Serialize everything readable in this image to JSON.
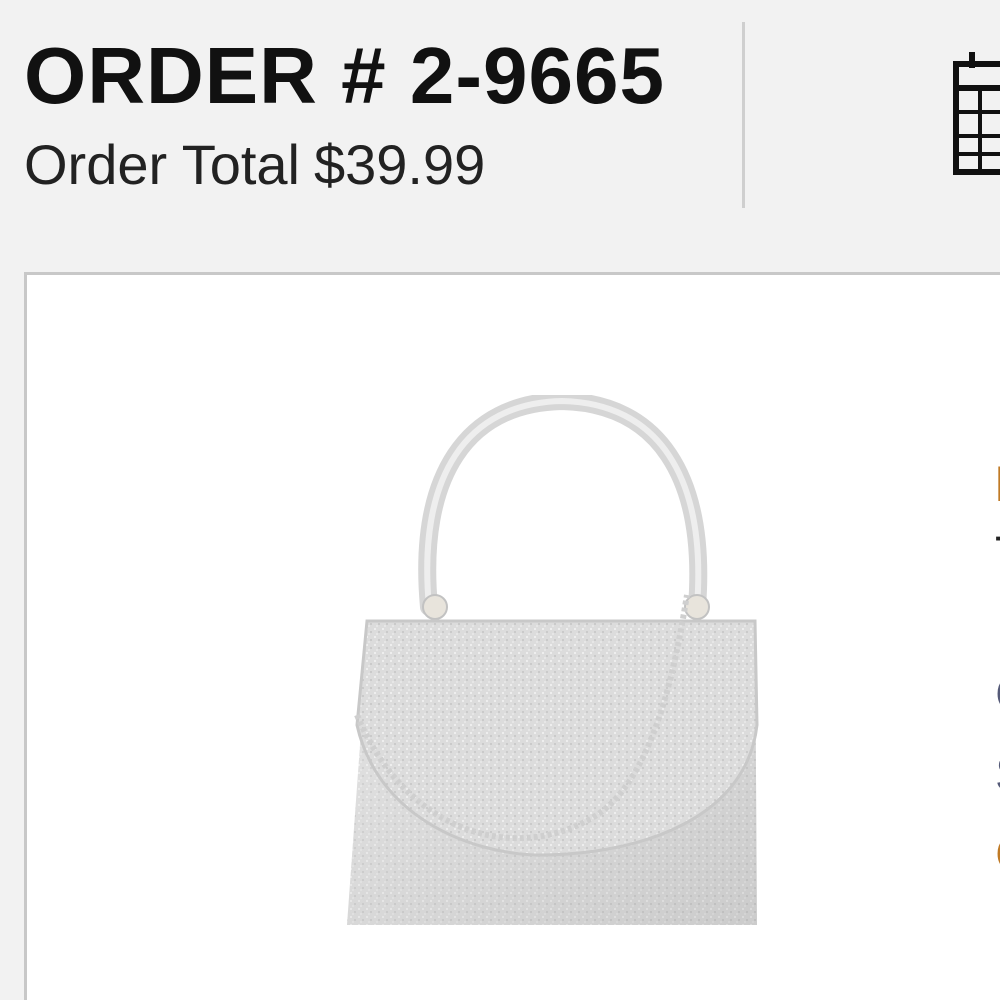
{
  "order": {
    "number": "ORDER # 2-9665",
    "total_label": "Order Total",
    "total_value": "$39.99"
  },
  "icons": {
    "calendar": "calendar-icon"
  },
  "product": {
    "image": "silver-rhinestone-mini-handbag",
    "partial_lines": {
      "brand": "I",
      "name": "T",
      "color": "C",
      "size": "S",
      "qty": "C"
    }
  },
  "colors": {
    "background": "#f2f2f2",
    "card": "#ffffff",
    "accent": "#c07a25",
    "text": "#111111"
  }
}
